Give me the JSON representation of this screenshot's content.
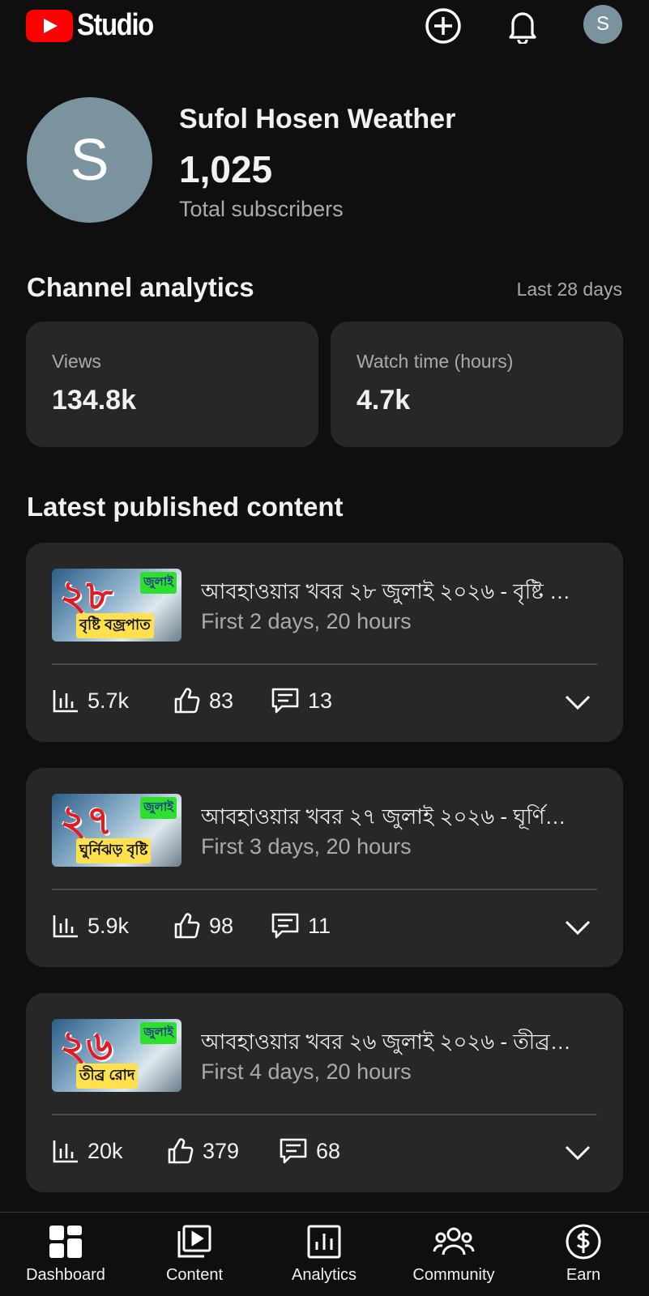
{
  "header": {
    "logo_text": "Studio",
    "avatar_letter": "S"
  },
  "channel": {
    "avatar_letter": "S",
    "name": "Sufol Hosen Weather",
    "subscribers": "1,025",
    "subscribers_label": "Total subscribers"
  },
  "analytics": {
    "title": "Channel analytics",
    "period": "Last 28 days",
    "cards": [
      {
        "label": "Views",
        "value": "134.8k"
      },
      {
        "label": "Watch time (hours)",
        "value": "4.7k"
      }
    ]
  },
  "latest": {
    "title": "Latest published content",
    "videos": [
      {
        "title": "আবহাওয়ার খবর ২৮ জুলাই ২০২৬ - বৃষ্টি …",
        "subtitle": "First 2 days, 20 hours",
        "thumb_number": "২৮",
        "thumb_month": "জুলাই",
        "thumb_caption": "বৃষ্টি বজ্রপাত",
        "views": "5.7k",
        "likes": "83",
        "comments": "13"
      },
      {
        "title": "আবহাওয়ার খবর ২৭ জুলাই ২০২৬  - ঘূর্ণি…",
        "subtitle": "First 3 days, 20 hours",
        "thumb_number": "২৭",
        "thumb_month": "জুলাই",
        "thumb_caption": "ঘুর্নিঝড় বৃষ্টি",
        "views": "5.9k",
        "likes": "98",
        "comments": "11"
      },
      {
        "title": "আবহাওয়ার খবর ২৬ জুলাই ২০২৬ - তীব্র…",
        "subtitle": "First 4 days, 20 hours",
        "thumb_number": "২৬",
        "thumb_month": "জুলাই",
        "thumb_caption": "তীব্র রোদ",
        "views": "20k",
        "likes": "379",
        "comments": "68"
      }
    ]
  },
  "nav": {
    "items": [
      {
        "label": "Dashboard",
        "icon": "dashboard-icon"
      },
      {
        "label": "Content",
        "icon": "content-icon"
      },
      {
        "label": "Analytics",
        "icon": "analytics-icon"
      },
      {
        "label": "Community",
        "icon": "community-icon"
      },
      {
        "label": "Earn",
        "icon": "earn-icon"
      }
    ]
  },
  "colors": {
    "background": "#0f0f0f",
    "card": "#272727",
    "brand_red": "#ff0000",
    "avatar": "#7b939e",
    "secondary_text": "#aaaaaa"
  }
}
